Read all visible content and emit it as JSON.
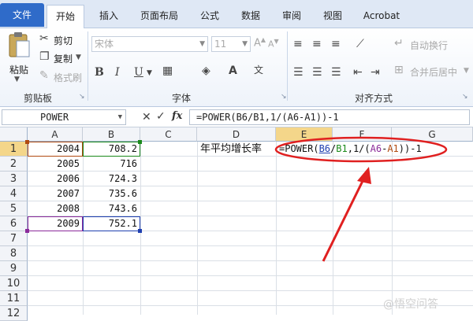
{
  "tabs": {
    "file": "文件",
    "home": "开始",
    "insert": "插入",
    "layout": "页面布局",
    "formula": "公式",
    "data": "数据",
    "review": "审阅",
    "view": "视图",
    "acrobat": "Acrobat"
  },
  "ribbon": {
    "paste": "粘贴",
    "cut": "剪切",
    "copy": "复制",
    "format_painter": "格式刷",
    "clipboard_group": "剪贴板",
    "font_name": "宋体",
    "font_size": "11",
    "bold": "B",
    "italic": "I",
    "underline": "U",
    "font_group": "字体",
    "wrap_text": "自动换行",
    "merge_center": "合并后居中",
    "alignment_group": "对齐方式"
  },
  "formula_bar": {
    "name_box": "POWER",
    "cancel_icon": "✕",
    "enter_icon": "✓",
    "fx": "fx",
    "formula": "=POWER(B6/B1,1/(A6-A1))-1"
  },
  "grid": {
    "columns": [
      "A",
      "B",
      "C",
      "D",
      "E",
      "F",
      "G"
    ],
    "rows": [
      "1",
      "2",
      "3",
      "4",
      "5",
      "6",
      "7",
      "8",
      "9",
      "10",
      "11",
      "12"
    ],
    "year_values": [
      "2004",
      "2005",
      "2006",
      "2007",
      "2008",
      "2009"
    ],
    "value_values": [
      "708.2",
      "716",
      "724.3",
      "735.6",
      "743.6",
      "752.1"
    ],
    "d1_label": "年平均增长率",
    "e1_formula": {
      "p1": "=POWER(",
      "ref_b6": "B6",
      "slash": "/",
      "ref_b1": "B1",
      "mid": ",1/(",
      "ref_a6": "A6",
      "minus": "-",
      "ref_a1": "A1",
      "end": "))-1"
    }
  },
  "colors": {
    "highlight_circle": "#e02020",
    "ref_b6": "#1f3fb0",
    "ref_b1": "#1a8a1a",
    "ref_a6": "#8a2a9a",
    "ref_a1": "#b04a10"
  },
  "watermark": "@悟空问答"
}
